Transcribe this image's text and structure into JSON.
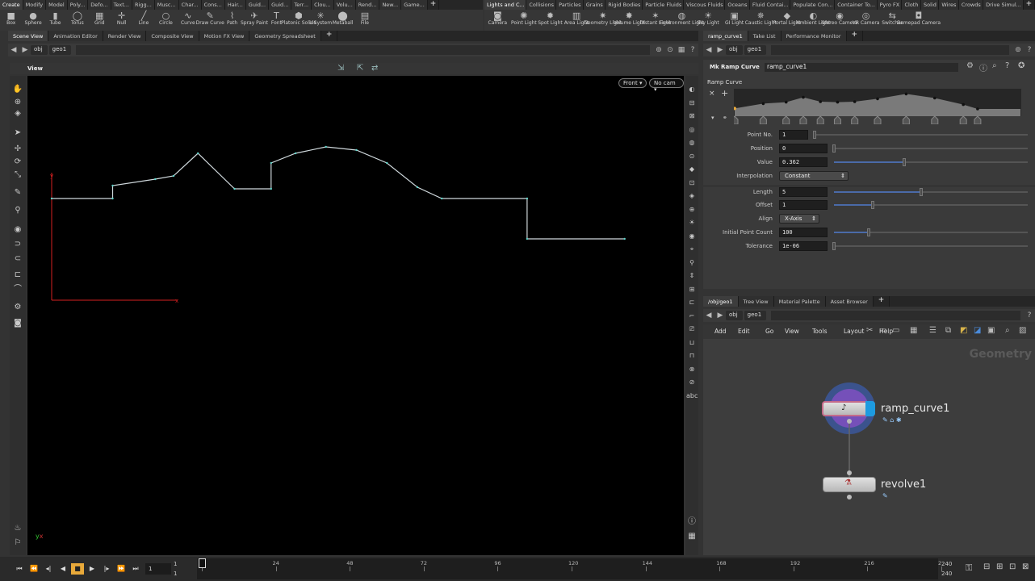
{
  "shelf_left": {
    "tabs": [
      "Create",
      "Modify",
      "Model",
      "Poly...",
      "Defo...",
      "Text...",
      "Rigg...",
      "Musc...",
      "Char...",
      "Cons...",
      "Hair...",
      "Guid...",
      "Guid...",
      "Terr...",
      "Clou...",
      "Volu...",
      "Rend...",
      "New...",
      "Game...",
      "+"
    ],
    "tools": [
      {
        "label": "Box",
        "icon": "box-icon",
        "glyph": "■"
      },
      {
        "label": "Sphere",
        "icon": "sphere-icon",
        "glyph": "●"
      },
      {
        "label": "Tube",
        "icon": "tube-icon",
        "glyph": "▮"
      },
      {
        "label": "Torus",
        "icon": "torus-icon",
        "glyph": "◯"
      },
      {
        "label": "Grid",
        "icon": "grid-icon",
        "glyph": "▦"
      },
      {
        "label": "Null",
        "icon": "null-icon",
        "glyph": "✛"
      },
      {
        "label": "Line",
        "icon": "line-icon",
        "glyph": "╱"
      },
      {
        "label": "Circle",
        "icon": "circle-icon",
        "glyph": "○"
      },
      {
        "label": "Curve",
        "icon": "curve-icon",
        "glyph": "∿"
      },
      {
        "label": "Draw Curve",
        "icon": "draw-curve-icon",
        "glyph": "✎"
      },
      {
        "label": "Path",
        "icon": "path-icon",
        "glyph": "⌇"
      },
      {
        "label": "Spray Paint",
        "icon": "spray-paint-icon",
        "glyph": "✈"
      },
      {
        "label": "Font",
        "icon": "font-icon",
        "glyph": "T"
      },
      {
        "label": "Platonic Solids",
        "icon": "platonic-icon",
        "glyph": "⬢"
      },
      {
        "label": "L-System",
        "icon": "lsystem-icon",
        "glyph": "✳"
      },
      {
        "label": "Metaball",
        "icon": "metaball-icon",
        "glyph": "⬤"
      },
      {
        "label": "File",
        "icon": "file-icon",
        "glyph": "▤"
      }
    ]
  },
  "shelf_right": {
    "tabs": [
      "Lights and C...",
      "Collisions",
      "Particles",
      "Grains",
      "Rigid Bodies",
      "Particle Fluids",
      "Viscous Fluids",
      "Oceans",
      "Fluid Contai...",
      "Populate Con...",
      "Container To...",
      "Pyro FX",
      "Cloth",
      "Solid",
      "Wires",
      "Crowds",
      "Drive Simul...",
      "+"
    ],
    "tools": [
      {
        "label": "Camera",
        "icon": "camera-icon",
        "glyph": "◙"
      },
      {
        "label": "Point Light",
        "icon": "point-light-icon",
        "glyph": "✺"
      },
      {
        "label": "Spot Light",
        "icon": "spot-light-icon",
        "glyph": "✹"
      },
      {
        "label": "Area Light",
        "icon": "area-light-icon",
        "glyph": "▥"
      },
      {
        "label": "Geometry Light",
        "icon": "geometry-light-icon",
        "glyph": "✷"
      },
      {
        "label": "Volume Light",
        "icon": "volume-light-icon",
        "glyph": "✸"
      },
      {
        "label": "Distant Light",
        "icon": "distant-light-icon",
        "glyph": "✶"
      },
      {
        "label": "Environment Light",
        "icon": "environment-light-icon",
        "glyph": "◍"
      },
      {
        "label": "Sky Light",
        "icon": "sky-light-icon",
        "glyph": "☀"
      },
      {
        "label": "GI Light",
        "icon": "gi-light-icon",
        "glyph": "▣"
      },
      {
        "label": "Caustic Light",
        "icon": "caustic-light-icon",
        "glyph": "✵"
      },
      {
        "label": "Portal Light",
        "icon": "portal-light-icon",
        "glyph": "◆"
      },
      {
        "label": "Ambient Light",
        "icon": "ambient-light-icon",
        "glyph": "◐"
      },
      {
        "label": "Stereo Camera",
        "icon": "stereo-camera-icon",
        "glyph": "◉"
      },
      {
        "label": "VR Camera",
        "icon": "vr-camera-icon",
        "glyph": "◎"
      },
      {
        "label": "Switcher",
        "icon": "switcher-icon",
        "glyph": "⇆"
      },
      {
        "label": "Gamepad Camera",
        "icon": "gamepad-camera-icon",
        "glyph": "◘"
      }
    ]
  },
  "left_pane": {
    "tabs": [
      "Scene View",
      "Animation Editor",
      "Render View",
      "Composite View",
      "Motion FX View",
      "Geometry Spreadsheet",
      "+"
    ],
    "path": [
      "obj",
      "geo1"
    ],
    "view_title": "View",
    "front_button": "Front",
    "cam_button": "No cam"
  },
  "right_top_pane": {
    "tabs": [
      "ramp_curve1",
      "Take List",
      "Performance Monitor",
      "+"
    ],
    "path": [
      "obj",
      "geo1"
    ],
    "node_type": "Mk Ramp Curve",
    "node_name": "ramp_curve1",
    "ramp_label": "Ramp Curve",
    "params": {
      "point_no_label": "Point No.",
      "point_no": "1",
      "position_label": "Position",
      "position": "0",
      "value_label": "Value",
      "value": "0.362",
      "interp_label": "Interpolation",
      "interp": "Constant",
      "length_label": "Length",
      "length": "5",
      "offset_label": "Offset",
      "offset": "1",
      "align_label": "Align",
      "align": "X-Axis",
      "init_label": "Initial Point Count",
      "init": "100",
      "tol_label": "Tolerance",
      "tol": "1e-06"
    }
  },
  "right_bottom_pane": {
    "tabs": [
      "/obj/geo1",
      "Tree View",
      "Material Palette",
      "Asset Browser",
      "+"
    ],
    "path": [
      "obj",
      "geo1"
    ],
    "menu": [
      "Add",
      "Edit",
      "Go",
      "View",
      "Tools",
      "Layout",
      "Help"
    ],
    "context_label": "Geometry",
    "nodes": [
      "ramp_curve1",
      "revolve1"
    ]
  },
  "timeline": {
    "start": "1",
    "start2": "1",
    "current": "1",
    "ticks": [
      "1",
      "24",
      "48",
      "72",
      "96",
      "120",
      "144",
      "168",
      "192",
      "216",
      "2"
    ],
    "end": "240",
    "end2": "240"
  },
  "curve_points": [
    [
      0,
      0.38
    ],
    [
      0.1,
      0.38
    ],
    [
      0.1,
      0.46
    ],
    [
      0.17,
      0.5
    ],
    [
      0.2,
      0.52
    ],
    [
      0.24,
      0.66
    ],
    [
      0.3,
      0.44
    ],
    [
      0.36,
      0.44
    ],
    [
      0.36,
      0.6
    ],
    [
      0.4,
      0.66
    ],
    [
      0.45,
      0.7
    ],
    [
      0.5,
      0.68
    ],
    [
      0.55,
      0.6
    ],
    [
      0.6,
      0.45
    ],
    [
      0.64,
      0.38
    ],
    [
      0.78,
      0.38
    ],
    [
      0.78,
      0.13
    ],
    [
      0.94,
      0.13
    ]
  ],
  "colors": {
    "accent": "#4a9bd6",
    "axis_x": "#d42020",
    "axis_y": "#d42020",
    "curve": "#cfd8dc",
    "point": "#5fd3c9"
  }
}
